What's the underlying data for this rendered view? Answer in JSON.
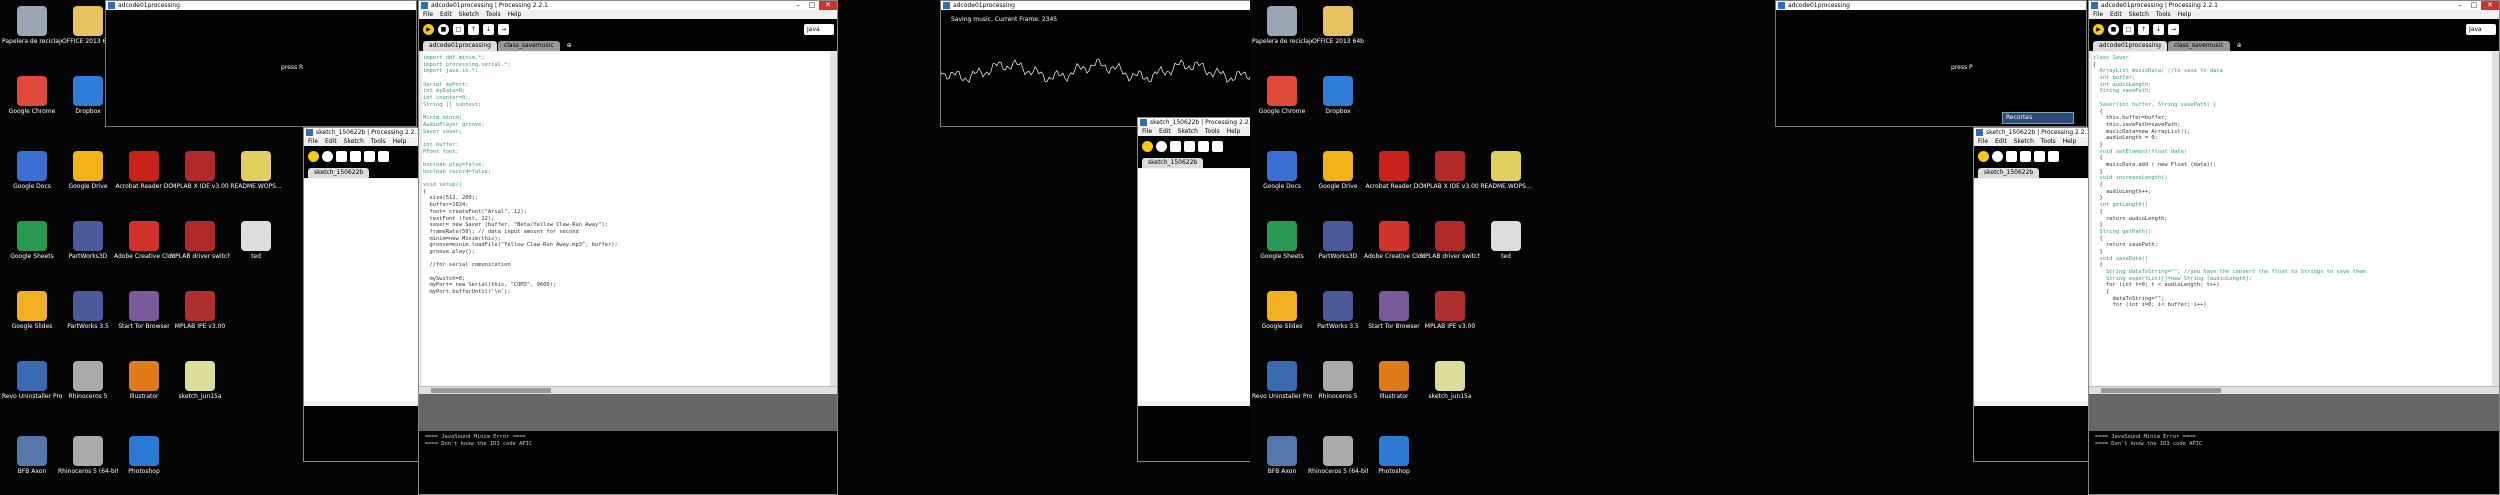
{
  "colors": {
    "accent": "#f9c81a",
    "editor_bg": "#ffffff",
    "toolbar_bg": "#000000",
    "title_bg": "#ffffff",
    "close": "#c8352b"
  },
  "desktop": {
    "icons": [
      {
        "name": "recycle-bin-icon",
        "label": "Papelera de reciclaje",
        "color": "#9aa6b4"
      },
      {
        "name": "office-folder-icon",
        "label": "OFFICE 2013 64b",
        "color": "#e8c460"
      },
      {
        "name": "chrome-icon",
        "label": "Google Chrome",
        "color": "#e04a3a"
      },
      {
        "name": "dropbox-icon",
        "label": "Dropbox",
        "color": "#2f7bd8"
      },
      {
        "name": "google-docs-icon",
        "label": "Google Docs",
        "color": "#3b6fd4"
      },
      {
        "name": "google-drive-icon",
        "label": "Google Drive",
        "color": "#f2b31a"
      },
      {
        "name": "acrobat-icon",
        "label": "Acrobat Reader DC",
        "color": "#c7231b"
      },
      {
        "name": "mplab-icon",
        "label": "MPLAB X IDE v3.00",
        "color": "#b02a2a"
      },
      {
        "name": "readme-icon",
        "label": "README.WOPS...",
        "color": "#e0d060"
      },
      {
        "name": "google-sheets-icon",
        "label": "Google Sheets",
        "color": "#2a9a52"
      },
      {
        "name": "partworks3d-icon",
        "label": "PartWorks3D",
        "color": "#4a5a9a"
      },
      {
        "name": "creative-cloud-icon",
        "label": "Adobe Creative Cloud",
        "color": "#d2332a"
      },
      {
        "name": "mplab-driver-icon",
        "label": "MPLAB driver switcher",
        "color": "#b02a2a"
      },
      {
        "name": "text-file-icon",
        "label": "ted",
        "color": "#dddddd"
      },
      {
        "name": "google-slides-icon",
        "label": "Google Slides",
        "color": "#f0b022"
      },
      {
        "name": "partworks35-icon",
        "label": "PartWorks 3.5",
        "color": "#4a5a9a"
      },
      {
        "name": "tor-browser-icon",
        "label": "Start Tor Browser",
        "color": "#7a5a9a"
      },
      {
        "name": "mplab-ipe-icon",
        "label": "MPLAB IPE v3.00",
        "color": "#b03030"
      },
      {
        "name": "revo-uninstaller-icon",
        "label": "Revo Uninstaller Pro",
        "color": "#3a6ab0"
      },
      {
        "name": "rhinoceros-icon",
        "label": "Rhinoceros 5",
        "color": "#aaaaaa"
      },
      {
        "name": "illustrator-icon",
        "label": "Illustrator",
        "color": "#e07b1a"
      },
      {
        "name": "sketch-file-icon",
        "label": "sketch_jun15a",
        "color": "#dddd99"
      },
      {
        "name": "bfb-axon-icon",
        "label": "BFB Axon",
        "color": "#5577aa"
      },
      {
        "name": "rhinoceros64-icon",
        "label": "Rhinoceros 5 (64-bit)",
        "color": "#aaaaaa"
      },
      {
        "name": "photoshop-icon",
        "label": "Photoshop",
        "color": "#2c7ad4"
      }
    ]
  },
  "processing": {
    "title": "adcode01processing | Processing 2.2.1",
    "menu": [
      "File",
      "Edit",
      "Sketch",
      "Tools",
      "Help"
    ],
    "mode": "Java",
    "tabs": [
      "adcode01processing",
      "class_savemusic"
    ],
    "small_title": "sketch_150622b | Processing 2.2.1",
    "small_tab": "sketch_150622b",
    "sketch_title": "adcode01processing",
    "press_text": "press R",
    "press_text_alt": "press P",
    "saving_text": "Saving music. Current Frame: 2345",
    "recorder_title": "Recortes",
    "code_main": [
      "import ddf.minim.*;",
      "import processing.serial.*;",
      "import java.io.*;",
      "",
      "Serial myPort;",
      "int myData=0;",
      "int counter=0;",
      "String [] subtext;",
      "",
      "Minim minim;",
      "AudioPlayer groove;",
      "Saver saver;",
      "",
      "int buffer;",
      "PFont font;",
      "",
      "boolean play=false;",
      "boolean record=false;",
      "",
      "void setup()",
      "{",
      "  size(512, 200);",
      "  buffer=1024;",
      "  font= createFont(\"Arial\", 12);",
      "  textFont (font, 12);",
      "  saver= new Saver (buffer, \"Beta/Yellow Claw-Run Away\");",
      "  frameRate(50); // data input amount for second",
      "  minim=new Minim(this);",
      "  groove=minim.loadFile(\"Yellow Claw-Run Away.mp3\", buffer);",
      "  groove.play();",
      "",
      "  //for serial comunication",
      "",
      "  mySwitch=0;",
      "  myPort= new Serial(this, \"COM3\", 9600);",
      "  myPort.bufferUntil('\\n');"
    ],
    "code_saver": [
      "class Saver",
      "{",
      "  ArrayList musicData; //to save to data",
      "  int buffer;",
      "  int audioLength;",
      "  String savePath;",
      "",
      "  Saver(int buffer, String savePath) {",
      "  {",
      "    this.buffer=buffer;",
      "    this.savePath=savePath;",
      "    musicData=new ArrayList();",
      "    audioLength = 0;",
      "  }",
      "  void setElement(float data)",
      "  {",
      "    musicData.add ( new Float (data));",
      "  }",
      "  void increaseLength()",
      "  {",
      "    audioLength++;",
      "  }",
      "  int getLength()",
      "  {",
      "    return audioLength;",
      "  }",
      "  String getPath()",
      "  {",
      "    return savePath;",
      "  }",
      "  void saveData()",
      "  {",
      "    String dataToString=\"\"; //you have the convert the float to Strings to save them",
      "    String exportList[]=new String [audioLength];",
      "    for (int t=0; t < audioLength; t++)",
      "    {",
      "      dataToString=\"\";",
      "      for (int i=0; i< buffer; i++)"
    ],
    "console": [
      "==== JavaSound Minim Error ====",
      "==== Don't know the ID3 code APIC"
    ]
  }
}
